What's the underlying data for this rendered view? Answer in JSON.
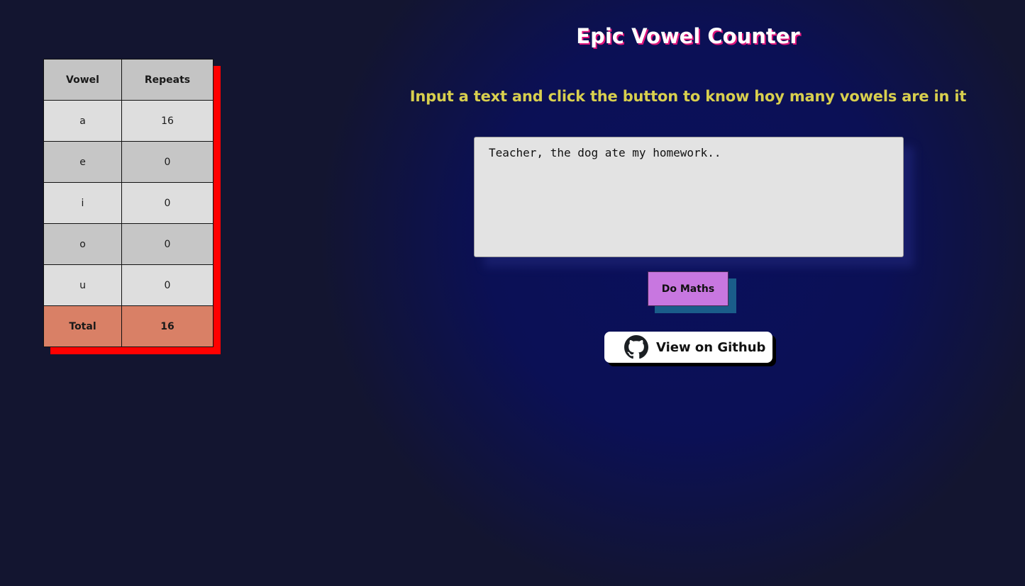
{
  "table": {
    "headers": {
      "vowel": "Vowel",
      "repeats": "Repeats"
    },
    "rows": [
      {
        "vowel": "a",
        "repeats": "16"
      },
      {
        "vowel": "e",
        "repeats": "0"
      },
      {
        "vowel": "i",
        "repeats": "0"
      },
      {
        "vowel": "o",
        "repeats": "0"
      },
      {
        "vowel": "u",
        "repeats": "0"
      }
    ],
    "total": {
      "label": "Total",
      "value": "16"
    }
  },
  "header": {
    "title": "Epic Vowel Counter",
    "subtitle": "Input a text and click the button to know hoy many vowels are in it"
  },
  "input": {
    "value": "Teacher, the dog ate my homework.."
  },
  "actions": {
    "do_maths_label": "Do Maths",
    "github_label": "View on Github",
    "github_icon": "github-icon"
  },
  "colors": {
    "title_shadow": "#e0157b",
    "subtitle": "#d8cf4e",
    "table_shadow": "#ff0000",
    "total_row": "#d98066",
    "button": "#c877e0",
    "button_shadow": "#1a5d8a"
  }
}
